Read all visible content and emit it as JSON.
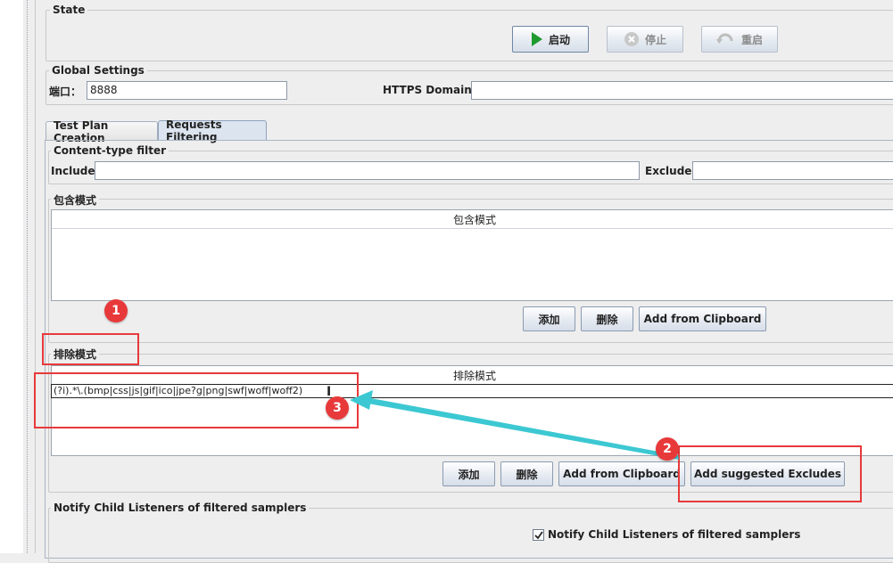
{
  "state": {
    "legend": "State",
    "start_label": "启动",
    "stop_label": "停止",
    "restart_label": "重启"
  },
  "global_settings": {
    "legend": "Global Settings",
    "port_label": "端口：",
    "port_value": "8888",
    "https_label": "HTTPS Domains:",
    "https_value": ""
  },
  "tabs": [
    {
      "label": "Test Plan Creation",
      "active": false
    },
    {
      "label": "Requests Filtering",
      "active": true
    }
  ],
  "content_type_filter": {
    "legend": "Content-type filter",
    "include_label": "Include:",
    "include_value": "",
    "exclude_label": "Exclude:",
    "exclude_value": ""
  },
  "include_patterns": {
    "legend": "包含模式",
    "column_header": "包含模式",
    "rows": [],
    "buttons": {
      "add": "添加",
      "delete": "删除",
      "clipboard": "Add from Clipboard"
    }
  },
  "exclude_patterns": {
    "legend": "排除模式",
    "column_header": "排除模式",
    "rows": [
      "(?i).*\\.(bmp|css|js|gif|ico|jpe?g|png|swf|woff|woff2)"
    ],
    "buttons": {
      "add": "添加",
      "delete": "删除",
      "clipboard": "Add from Clipboard",
      "suggested": "Add suggested Excludes"
    }
  },
  "notify": {
    "legend": "Notify Child Listeners of filtered samplers",
    "checkbox_label": "Notify Child Listeners of filtered samplers",
    "checked": true
  },
  "annotations": {
    "markers": [
      "1",
      "2",
      "3"
    ],
    "color": "#e8393a",
    "arrow_color": "#3cc8d2"
  },
  "colors": {
    "play_green": "#1e9a2e",
    "panel_bg": "#eeeeee",
    "button_border": "#8a9bb1"
  }
}
